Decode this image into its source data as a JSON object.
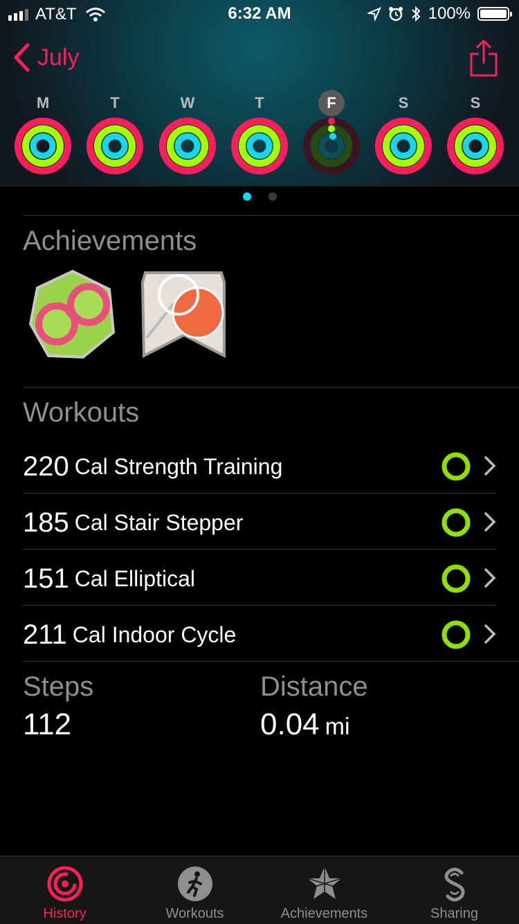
{
  "status_bar": {
    "carrier": "AT&T",
    "time": "6:32 AM",
    "battery": "100%"
  },
  "nav": {
    "back_label": "July"
  },
  "week": {
    "days": [
      {
        "label": "M",
        "selected": false
      },
      {
        "label": "T",
        "selected": false
      },
      {
        "label": "W",
        "selected": false
      },
      {
        "label": "T",
        "selected": false
      },
      {
        "label": "F",
        "selected": true
      },
      {
        "label": "S",
        "selected": false
      },
      {
        "label": "S",
        "selected": false
      }
    ]
  },
  "achievements": {
    "title": "Achievements"
  },
  "workouts": {
    "title": "Workouts",
    "items": [
      {
        "calories": "220",
        "name": "Cal Strength Training"
      },
      {
        "calories": "185",
        "name": "Cal Stair Stepper"
      },
      {
        "calories": "151",
        "name": "Cal Elliptical"
      },
      {
        "calories": "211",
        "name": "Cal Indoor Cycle"
      }
    ]
  },
  "stats": {
    "steps_label": "Steps",
    "steps_value": "112",
    "distance_label": "Distance",
    "distance_value": "0.04",
    "distance_unit": "mi"
  },
  "tabs": [
    {
      "label": "History",
      "icon": "history-icon",
      "active": true
    },
    {
      "label": "Workouts",
      "icon": "workouts-icon",
      "active": false
    },
    {
      "label": "Achievements",
      "icon": "achievements-icon",
      "active": false
    },
    {
      "label": "Sharing",
      "icon": "sharing-icon",
      "active": false
    }
  ],
  "colors": {
    "accent": "#fa1e5a",
    "move": "#fa1e5a",
    "exercise": "#a6ff00",
    "stand": "#1ad6e8",
    "workout_ring": "#8fe000"
  }
}
